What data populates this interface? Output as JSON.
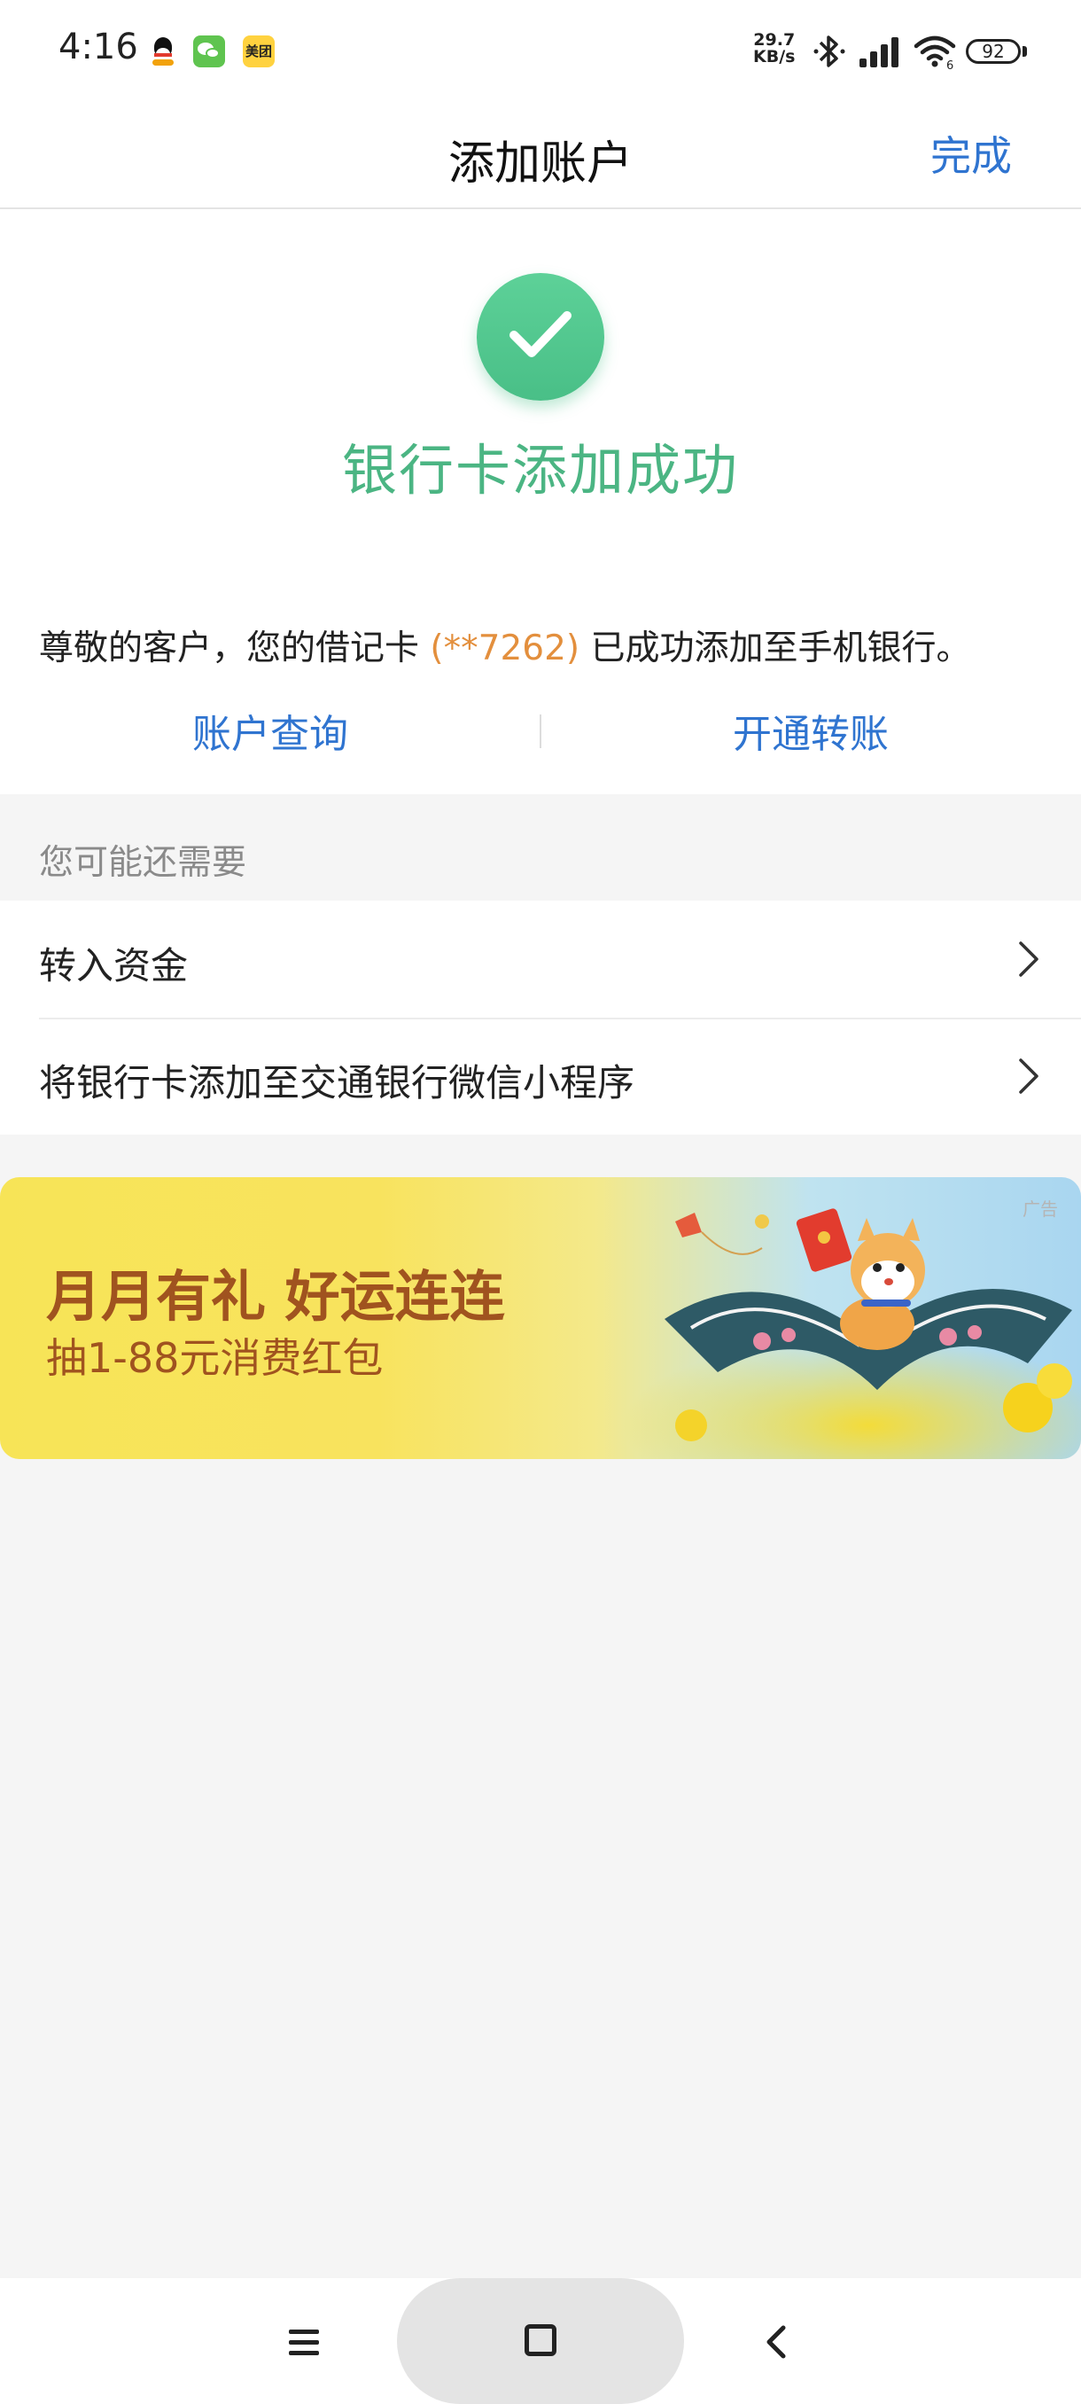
{
  "status_bar": {
    "time": "4:16",
    "meituan_label": "美团",
    "net_speed_value": "29.7",
    "net_speed_unit": "KB/s",
    "wifi_label": "6",
    "battery": "92",
    "icons": [
      "qq-icon",
      "wechat-icon",
      "meituan-icon",
      "bluetooth-icon",
      "signal-icon",
      "wifi-icon",
      "battery-icon"
    ]
  },
  "header": {
    "title": "添加账户",
    "done_label": "完成"
  },
  "success": {
    "icon": "check-icon",
    "title": "银行卡添加成功",
    "desc_prefix": "尊敬的客户，您的借记卡",
    "card_no": "(**7262)",
    "desc_suffix": "已成功添加至手机银行。",
    "link_query": "账户查询",
    "link_transfer": "开通转账",
    "accent_color": "#4bb583",
    "link_color": "#2f74d0",
    "highlight_color": "#e38f3d"
  },
  "more": {
    "section_label": "您可能还需要",
    "items": [
      {
        "label": "转入资金"
      },
      {
        "label": "将银行卡添加至交通银行微信小程序"
      }
    ]
  },
  "banner": {
    "ad_tag": "广告",
    "title": "月月有礼 好运连连",
    "subtitle": "抽1-88元消费红包"
  },
  "system_nav": {
    "icons": [
      "menu-icon",
      "home-icon",
      "back-icon"
    ]
  }
}
